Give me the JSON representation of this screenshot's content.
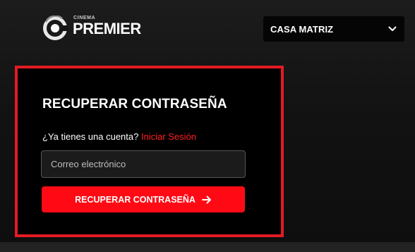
{
  "header": {
    "logo": {
      "small_text": "CINEMA",
      "brand_text": "PREMIER",
      "icon": "premier-logo-icon"
    },
    "branch_select": {
      "value": "CASA MATRIZ",
      "icon": "chevron-down-icon"
    }
  },
  "recover_form": {
    "title": "RECUPERAR CONTRASEÑA",
    "account_question": "¿Ya tienes una cuenta?",
    "login_link": "Iniciar Sesión",
    "email_placeholder": "Correo electrónico",
    "email_value": "",
    "submit_label": "RECUPERAR CONTRASEÑA",
    "submit_icon": "arrow-right-icon"
  },
  "colors": {
    "accent": "#ff0a14",
    "card_border": "#e31b23",
    "link": "#ff1e27",
    "background": "#141414",
    "card_background": "#000000",
    "input_background": "#1b1b1b"
  }
}
